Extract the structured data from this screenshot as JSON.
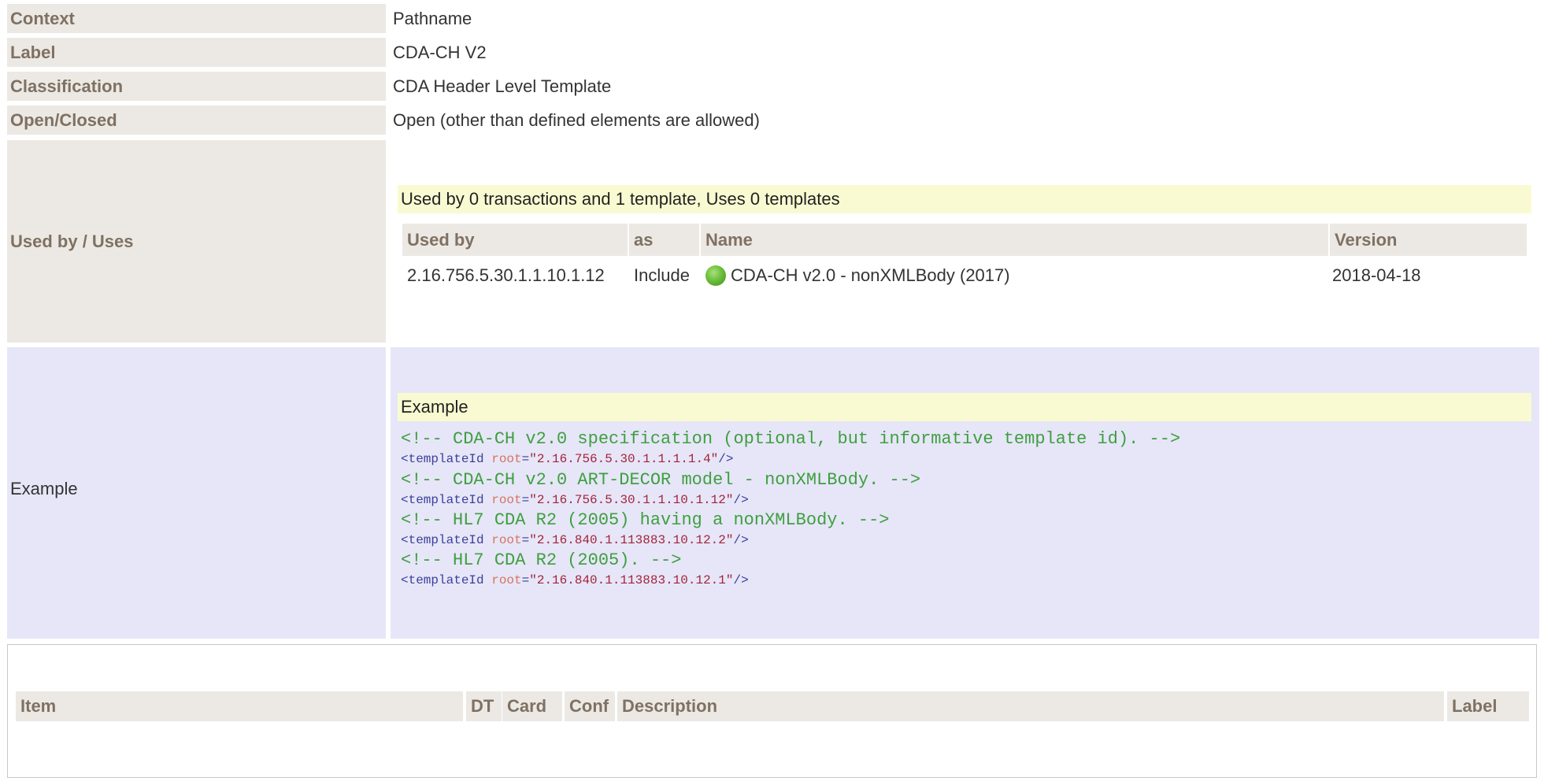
{
  "rows": {
    "context": {
      "label": "Context",
      "value": "Pathname"
    },
    "label": {
      "label": "Label",
      "value": "CDA-CH V2"
    },
    "classification": {
      "label": "Classification",
      "value": "CDA Header Level Template"
    },
    "openclosed": {
      "label": "Open/Closed",
      "value": "Open (other than defined elements are allowed)"
    },
    "usedby": {
      "label": "Used by / Uses"
    },
    "example": {
      "label": "Example"
    }
  },
  "usedby": {
    "summary": "Used by 0 transactions and 1 template, Uses 0 templates",
    "headers": {
      "used_by": "Used by",
      "as": "as",
      "name": "Name",
      "version": "Version"
    },
    "row": {
      "used_by": "2.16.756.5.30.1.1.10.1.12",
      "as": "Include",
      "name": "CDA-CH v2.0 - nonXMLBody (2017)",
      "version": "2018-04-18"
    }
  },
  "example": {
    "title": "Example",
    "lines": [
      {
        "comment": "<!-- CDA-CH v2.0 specification (optional, but informative template id). -->"
      },
      {
        "tag_open": "<templateId ",
        "attr": "root",
        "eq": "=",
        "value": "\"2.16.756.5.30.1.1.1.1.4\"",
        "tag_close": "/>"
      },
      {
        "comment": "<!-- CDA-CH v2.0 ART-DECOR model - nonXMLBody. -->"
      },
      {
        "tag_open": "<templateId ",
        "attr": "root",
        "eq": "=",
        "value": "\"2.16.756.5.30.1.1.10.1.12\"",
        "tag_close": "/>"
      },
      {
        "comment": "<!-- HL7 CDA R2 (2005) having a nonXMLBody. -->"
      },
      {
        "tag_open": "<templateId ",
        "attr": "root",
        "eq": "=",
        "value": "\"2.16.840.1.113883.10.12.2\"",
        "tag_close": "/>"
      },
      {
        "comment": "<!-- HL7 CDA R2 (2005). -->"
      },
      {
        "tag_open": "<templateId ",
        "attr": "root",
        "eq": "=",
        "value": "\"2.16.840.1.113883.10.12.1\"",
        "tag_close": "/>"
      }
    ]
  },
  "items_table": {
    "headers": {
      "item": "Item",
      "dt": "DT",
      "card": "Card",
      "conf": "Conf",
      "description": "Description",
      "label": "Label"
    }
  },
  "colors": {
    "header_bg": "#ece9e4",
    "header_text": "#7f7163",
    "highlight_bg": "#fafad2",
    "example_bg": "#e6e6f8",
    "comment": "#3f9f3f",
    "tag": "#3b3f9b",
    "attr": "#d8735e",
    "value": "#a4243b",
    "status_dot": "#6cbf3a"
  },
  "icons": {
    "status": "green-status-dot-icon"
  }
}
